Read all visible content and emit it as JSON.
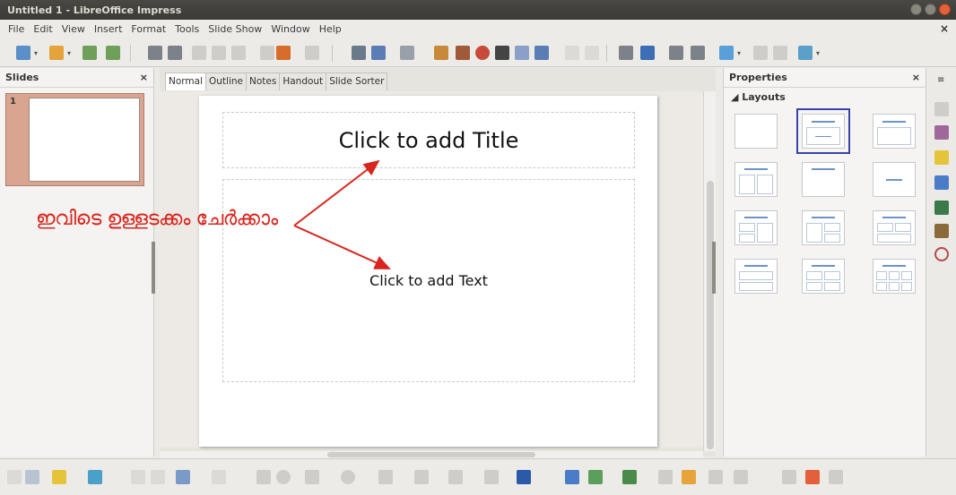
{
  "window": {
    "title": "Untitled 1 - LibreOffice Impress"
  },
  "menu": [
    "File",
    "Edit",
    "View",
    "Insert",
    "Format",
    "Tools",
    "Slide Show",
    "Window",
    "Help"
  ],
  "menu_close": "×",
  "slides_panel": {
    "title": "Slides",
    "close": "×",
    "slide_number": "1"
  },
  "view_tabs": [
    "Normal",
    "Outline",
    "Notes",
    "Handout",
    "Slide Sorter"
  ],
  "slide": {
    "title_placeholder": "Click to add Title",
    "text_placeholder": "Click to add Text"
  },
  "annotation": {
    "text": "ഇവിടെ ഉള്ളടക്കം ചേർക്കാം",
    "color": "#d8261e"
  },
  "properties": {
    "title": "Properties",
    "close": "×",
    "section": "◢ Layouts"
  },
  "colors": {
    "accent_selection": "#3744a6",
    "slide_thumb_selection": "#d9a591"
  }
}
